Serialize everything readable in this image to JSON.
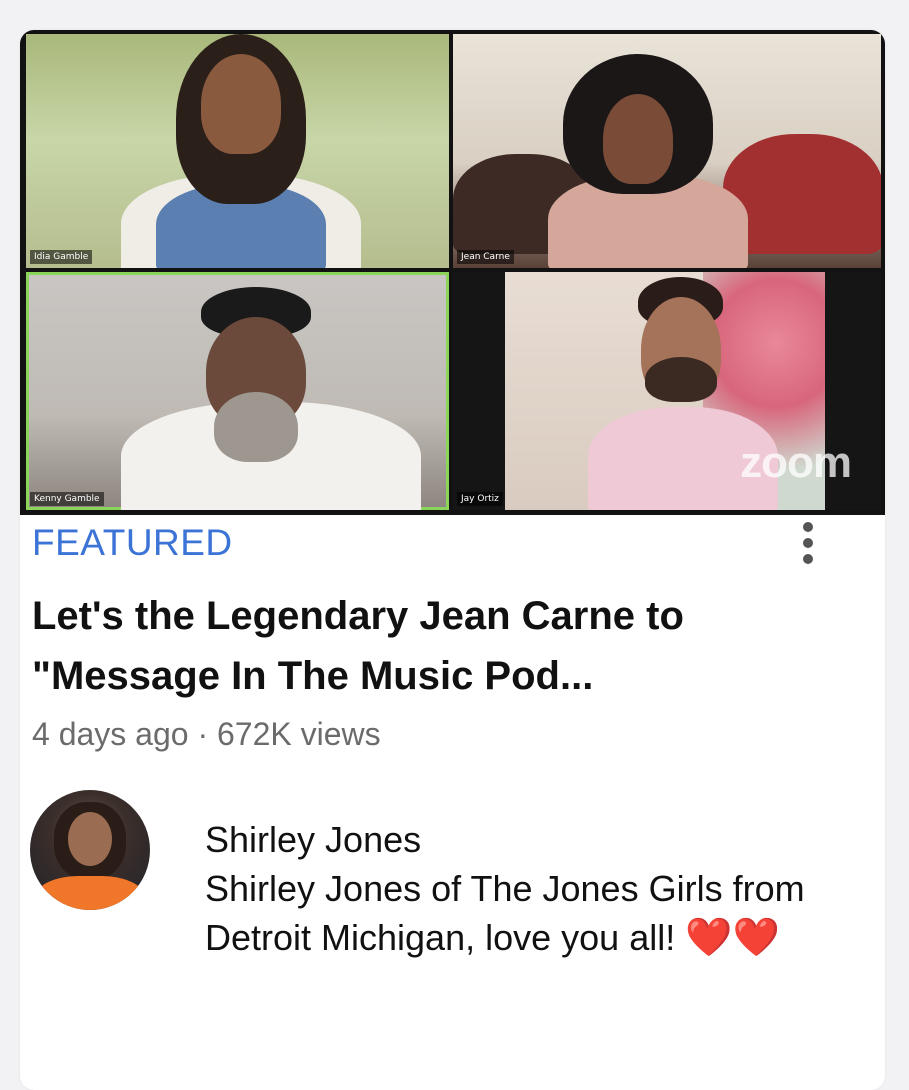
{
  "thumbnail": {
    "participants": [
      {
        "name": "Idia Gamble"
      },
      {
        "name": "Jean Carne"
      },
      {
        "name": "Kenny Gamble"
      },
      {
        "name": "Jay Ortiz"
      }
    ],
    "watermark": "zoom"
  },
  "video": {
    "badge": "FEATURED",
    "title": "Let's the Legendary Jean Carne to \"Message In The Music Pod...",
    "meta": "4 days ago · 672K views",
    "more_icon": "more-vertical-icon"
  },
  "comment": {
    "author": "Shirley Jones",
    "text": "Shirley Jones of The Jones Girls from Detroit Michigan, love you all!",
    "emoji": "❤️❤️"
  },
  "colors": {
    "accent": "#3c73d6",
    "active_speaker_border": "#8bd65a",
    "heart": "#e0141e"
  }
}
